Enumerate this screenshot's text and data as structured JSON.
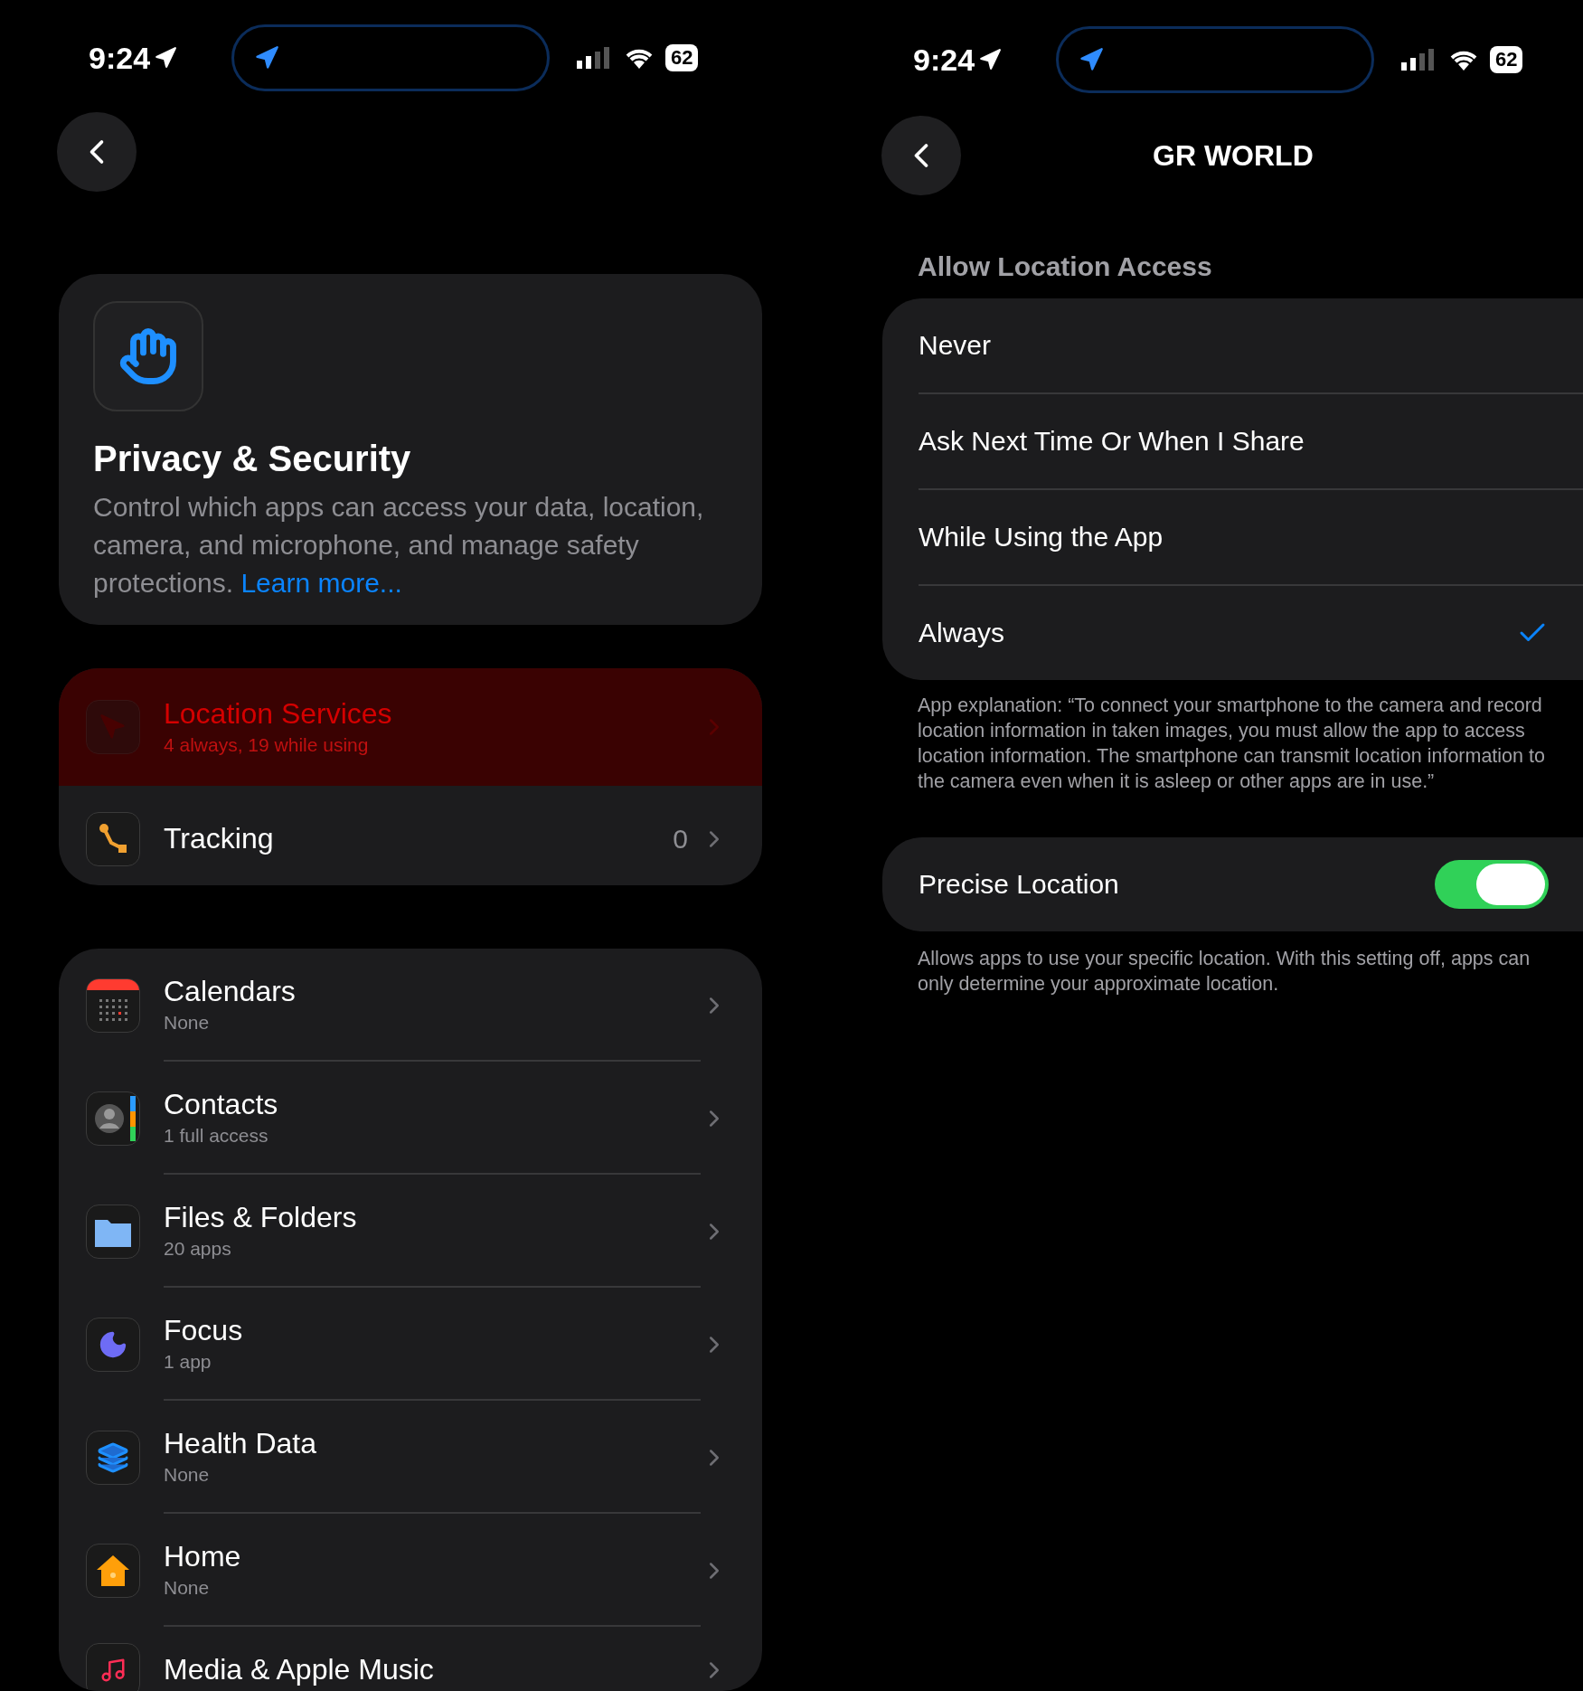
{
  "left_screen": {
    "status_bar": {
      "time": "9:24",
      "battery": "62"
    },
    "header_card": {
      "title": "Privacy & Security",
      "description": "Control which apps can access your data, location, camera, and microphone, and manage safety protections.",
      "link": "Learn more..."
    },
    "location_group": [
      {
        "kind": "location",
        "title": "Location Services",
        "subtitle": "4 always, 19 while using",
        "highlighted": true
      },
      {
        "kind": "tracking",
        "title": "Tracking",
        "value": "0",
        "highlighted": false
      }
    ],
    "apps_group": [
      {
        "kind": "calendar",
        "title": "Calendars",
        "subtitle": "None"
      },
      {
        "kind": "contacts",
        "title": "Contacts",
        "subtitle": "1 full access"
      },
      {
        "kind": "folder",
        "title": "Files & Folders",
        "subtitle": "20 apps"
      },
      {
        "kind": "focus",
        "title": "Focus",
        "subtitle": "1 app"
      },
      {
        "kind": "health",
        "title": "Health Data",
        "subtitle": "None"
      },
      {
        "kind": "home",
        "title": "Home",
        "subtitle": "None"
      },
      {
        "kind": "music",
        "title": "Media & Apple Music"
      }
    ]
  },
  "right_screen": {
    "status_bar": {
      "time": "9:24",
      "battery": "62"
    },
    "title": "GR WORLD",
    "section_label": "Allow Location Access",
    "options": [
      {
        "label": "Never",
        "selected": false
      },
      {
        "label": "Ask Next Time Or When I Share",
        "selected": false
      },
      {
        "label": "While Using the App",
        "selected": false
      },
      {
        "label": "Always",
        "selected": true
      }
    ],
    "explanation": "App explanation: “To connect your smartphone to the camera and record location information in taken images, you must allow the app to access location information. The smartphone can transmit location information to the camera even when it is asleep or other apps are in use.”",
    "precise_location": {
      "label": "Precise Location",
      "on": true,
      "footer": "Allows apps to use your specific location. With this setting off, apps can only determine your approximate location."
    }
  }
}
